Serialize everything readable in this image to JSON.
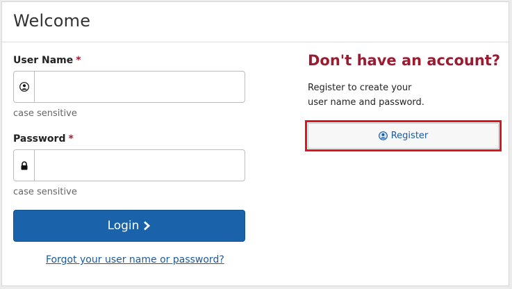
{
  "header": {
    "title": "Welcome"
  },
  "login_form": {
    "username": {
      "label": "User Name",
      "required_marker": "*",
      "value": "",
      "placeholder": "",
      "hint": "case sensitive",
      "icon": "user-icon"
    },
    "password": {
      "label": "Password",
      "required_marker": "*",
      "value": "",
      "placeholder": "",
      "hint": "case sensitive",
      "icon": "lock-icon"
    },
    "login_label": "Login",
    "login_icon": "chevron-right-icon",
    "forgot_link": "Forgot your user name or password?"
  },
  "register": {
    "heading": "Don't have an account?",
    "description_line1": "Register to create your",
    "description_line2": "user name and password.",
    "button_label": "Register",
    "button_icon": "user-icon",
    "highlight_color": "#e0141e"
  },
  "colors": {
    "accent_blue": "#1a63ab",
    "heading_red": "#9b1c31",
    "link_blue": "#1a5a9a"
  }
}
